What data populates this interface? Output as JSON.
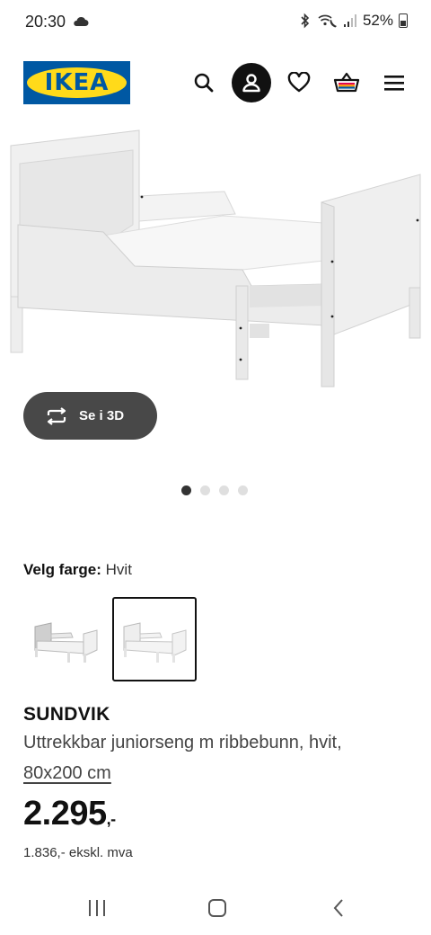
{
  "status_bar": {
    "time": "20:30",
    "battery": "52%",
    "icons": [
      "cloud-icon",
      "bluetooth-icon",
      "wifi-call-icon",
      "signal-icon",
      "battery-icon"
    ]
  },
  "header": {
    "logo_text": "IKEA",
    "brand_blue": "#0058a3",
    "brand_yellow": "#ffda1a",
    "icons": [
      "search-icon",
      "profile-icon",
      "heart-icon",
      "cart-icon",
      "menu-icon"
    ]
  },
  "gallery": {
    "view_3d_label": "Se i 3D",
    "dots_count": 4,
    "active_dot": 0
  },
  "color_picker": {
    "label": "Velg farge:",
    "selected_value": "Hvit",
    "options_count": 2,
    "selected_index": 1
  },
  "product": {
    "name": "SUNDVIK",
    "description": "Uttrekkbar juniorseng m ribbebunn, hvit,",
    "size": "80x200 cm",
    "price": "2.295",
    "price_suffix": ",-",
    "price_ex_vat": "1.836,- ekskl. mva"
  },
  "nav_bar": {
    "icons": [
      "recent-apps-icon",
      "home-icon",
      "back-icon"
    ]
  }
}
